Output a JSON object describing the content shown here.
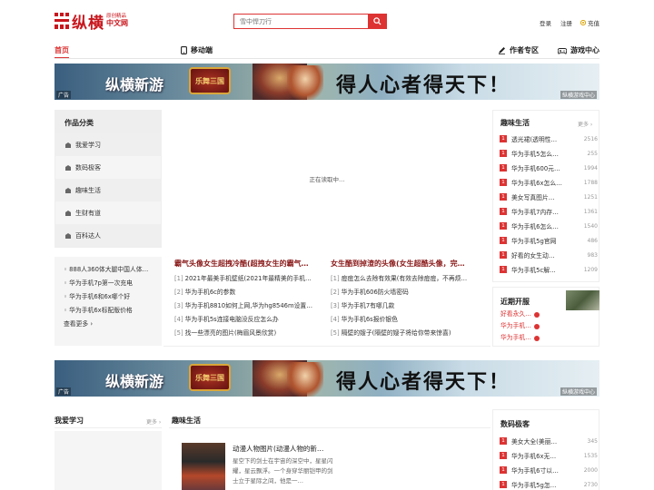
{
  "header": {
    "logo_text": "纵横",
    "logo_sub": "原创精品",
    "logo_sub2": "中文网",
    "search_placeholder": "雪中悍刀行",
    "login": "登录",
    "register": "注册",
    "recharge": "充值"
  },
  "nav": {
    "home": "首页",
    "mobile": "移动端",
    "author": "作者专区",
    "game": "游戏中心"
  },
  "banner": {
    "game_name": "纵横新游",
    "medal": "乐舞三国",
    "slogan": "得人心者得天下！",
    "ad": "广告",
    "source": "纵横游戏中心"
  },
  "categories": {
    "title": "作品分类",
    "items": [
      "我爱学习",
      "数码极客",
      "趣味生活",
      "生财有道",
      "百科达人"
    ],
    "links": [
      "888人360体大腿中国人体…",
      "华为手机7p第一次充电",
      "华为手机6和6x哪个好",
      "华为手机6x标配版价格"
    ],
    "more": "查看更多 ›"
  },
  "center": {
    "loading": "正在读取中…",
    "left_head": "霸气头像女生超拽冷酷(超拽女生的霸气…",
    "right_head": "女生酷到掉渣的头像(女生超酷头像，完…",
    "left_list": [
      {
        "n": "[1]",
        "t": "2021年最美手机壁纸(2021年最精美的手机…"
      },
      {
        "n": "[2]",
        "t": "华为手机6c的参数"
      },
      {
        "n": "[3]",
        "t": "华为手机8810如何上网,华为hg8546m设置…"
      },
      {
        "n": "[4]",
        "t": "华为手机5s连接电脑没反应怎么办"
      },
      {
        "n": "[5]",
        "t": "找一些漂亮的图片(梅眉风景欣赏)"
      }
    ],
    "right_list": [
      {
        "n": "[1]",
        "t": "痘痘怎么去除有效果(有效去除痘痘，不再烦…"
      },
      {
        "n": "[2]",
        "t": "华为手机606防火墙密码"
      },
      {
        "n": "[3]",
        "t": "华为手机7有哪几款"
      },
      {
        "n": "[4]",
        "t": "华为手机6s报价银色"
      },
      {
        "n": "[5]",
        "t": "隔壁的嫂子(隔壁的嫂子将给你带来惊喜)"
      }
    ]
  },
  "fun_life": {
    "title": "趣味生活",
    "more": "更多 ›",
    "items": [
      {
        "n": "1",
        "t": "透光裙(透明性…",
        "c": "2516"
      },
      {
        "n": "1",
        "t": "华为手机5怎么…",
        "c": "255"
      },
      {
        "n": "1",
        "t": "华为手机600元…",
        "c": "1994"
      },
      {
        "n": "1",
        "t": "华为手机6x怎么…",
        "c": "1788"
      },
      {
        "n": "1",
        "t": "美女写真图片…",
        "c": "1251"
      },
      {
        "n": "1",
        "t": "华为手机7内存…",
        "c": "1361"
      },
      {
        "n": "1",
        "t": "华为手机6怎么…",
        "c": "1540"
      },
      {
        "n": "1",
        "t": "华为手机5g官网",
        "c": "486"
      },
      {
        "n": "1",
        "t": "好看的女生动…",
        "c": "983"
      },
      {
        "n": "1",
        "t": "华为手机5c解…",
        "c": "1209"
      }
    ]
  },
  "recent": {
    "title": "近期开服",
    "links": [
      "好看永久…",
      "华为手机…",
      "华为手机…"
    ]
  },
  "bottom": {
    "study_title": "我爱学习",
    "study_more": "更多 ›",
    "fun_title": "趣味生活",
    "article_title": "动漫人物图片(动漫人物的新…",
    "article_desc": "星空下的剑士在宇宙的深空中，星星闪耀，星云飘浮。一个身穿华丽铠甲的剑士立于星际之间，他是一…",
    "digital_title": "数码极客",
    "digital_items": [
      {
        "n": "1",
        "t": "美女大全(美丽…",
        "c": "345"
      },
      {
        "n": "1",
        "t": "华为手机6x无…",
        "c": "1535"
      },
      {
        "n": "1",
        "t": "华为手机6寸以…",
        "c": "2000"
      },
      {
        "n": "1",
        "t": "华为手机5g怎…",
        "c": "2730"
      }
    ]
  },
  "colors": {
    "accent": "#d33333",
    "heading_red": "#8b1a1a"
  }
}
